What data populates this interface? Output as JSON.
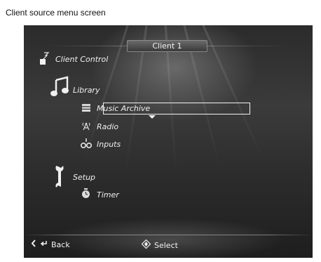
{
  "caption": "Client source menu screen",
  "header": {
    "title": "Client 1"
  },
  "sections": {
    "client_control": {
      "label": "Client Control"
    },
    "library": {
      "label": "Library",
      "items": [
        {
          "label": "Music Archive",
          "icon": "music-archive-icon",
          "selected": true
        },
        {
          "label": "Radio",
          "icon": "radio-tower-icon"
        },
        {
          "label": "Inputs",
          "icon": "inputs-icon"
        }
      ]
    },
    "setup": {
      "label": "Setup",
      "items": [
        {
          "label": "Timer",
          "icon": "timer-icon"
        }
      ]
    }
  },
  "footer": {
    "back_label": "Back",
    "select_label": "Select"
  }
}
